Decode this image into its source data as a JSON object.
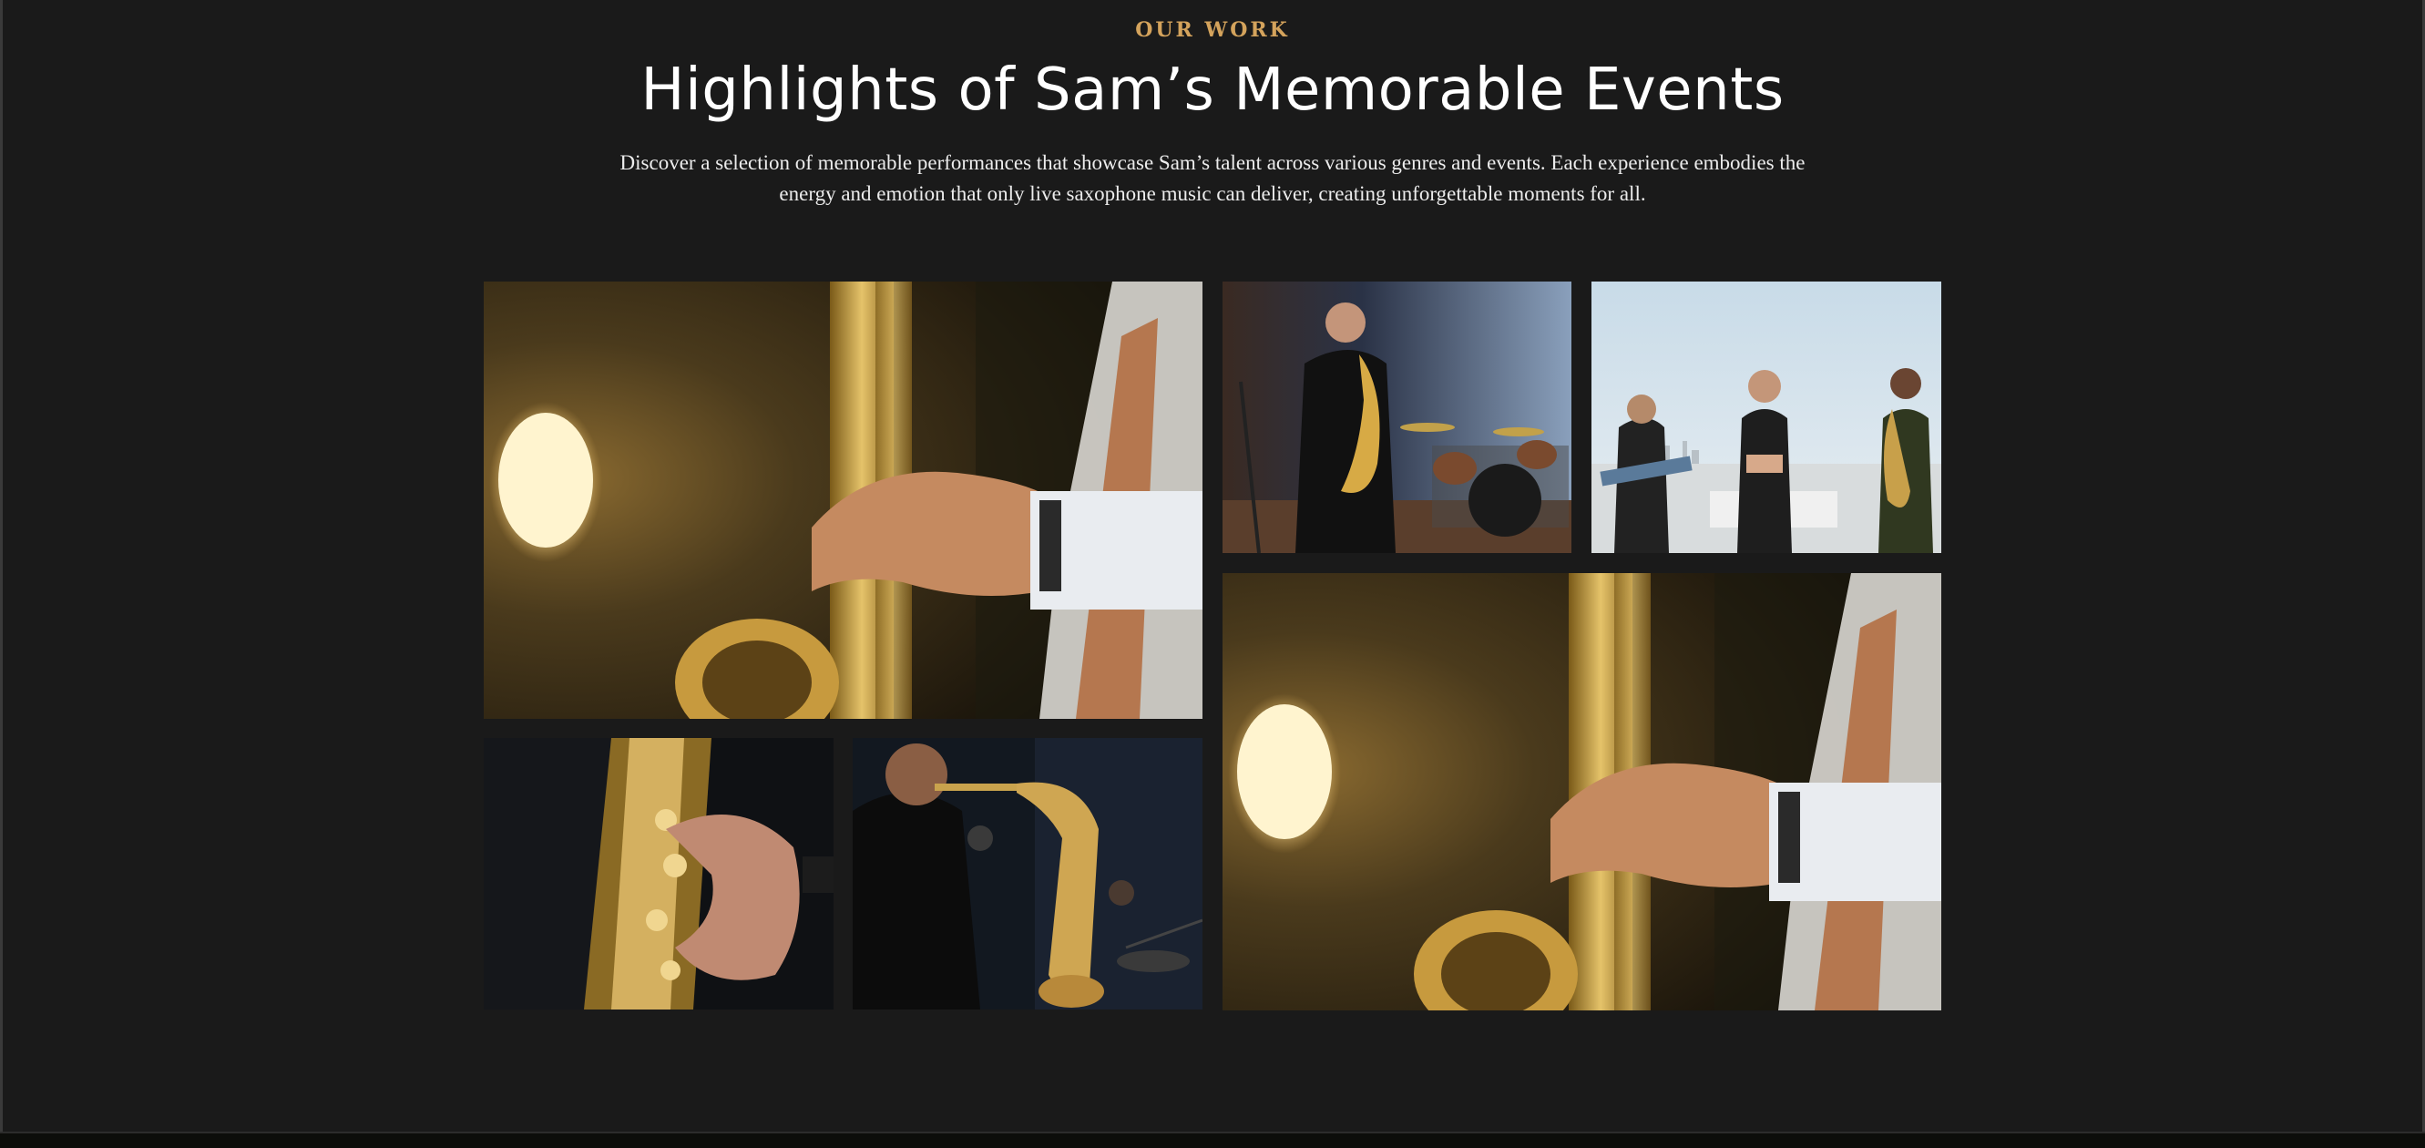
{
  "section": {
    "eyebrow": "OUR WORK",
    "title": "Highlights of Sam’s Memorable Events",
    "description": "Discover a selection of memorable performances that showcase Sam’s talent across various genres and events. Each experience embodies the energy and emotion that only live saxophone music can deliver, creating unforgettable moments for all."
  },
  "colors": {
    "background": "#1a1a1a",
    "accent": "#d4a35c",
    "title": "#ffffff",
    "body_text": "#ececec"
  },
  "gallery": {
    "images": [
      {
        "name": "saxophone-closeup-spotlight"
      },
      {
        "name": "saxophonist-studio-drums"
      },
      {
        "name": "rooftop-band-performance"
      },
      {
        "name": "saxophone-keys-hand"
      },
      {
        "name": "saxophonist-microphone-band"
      },
      {
        "name": "saxophone-closeup-spotlight-large"
      }
    ]
  }
}
